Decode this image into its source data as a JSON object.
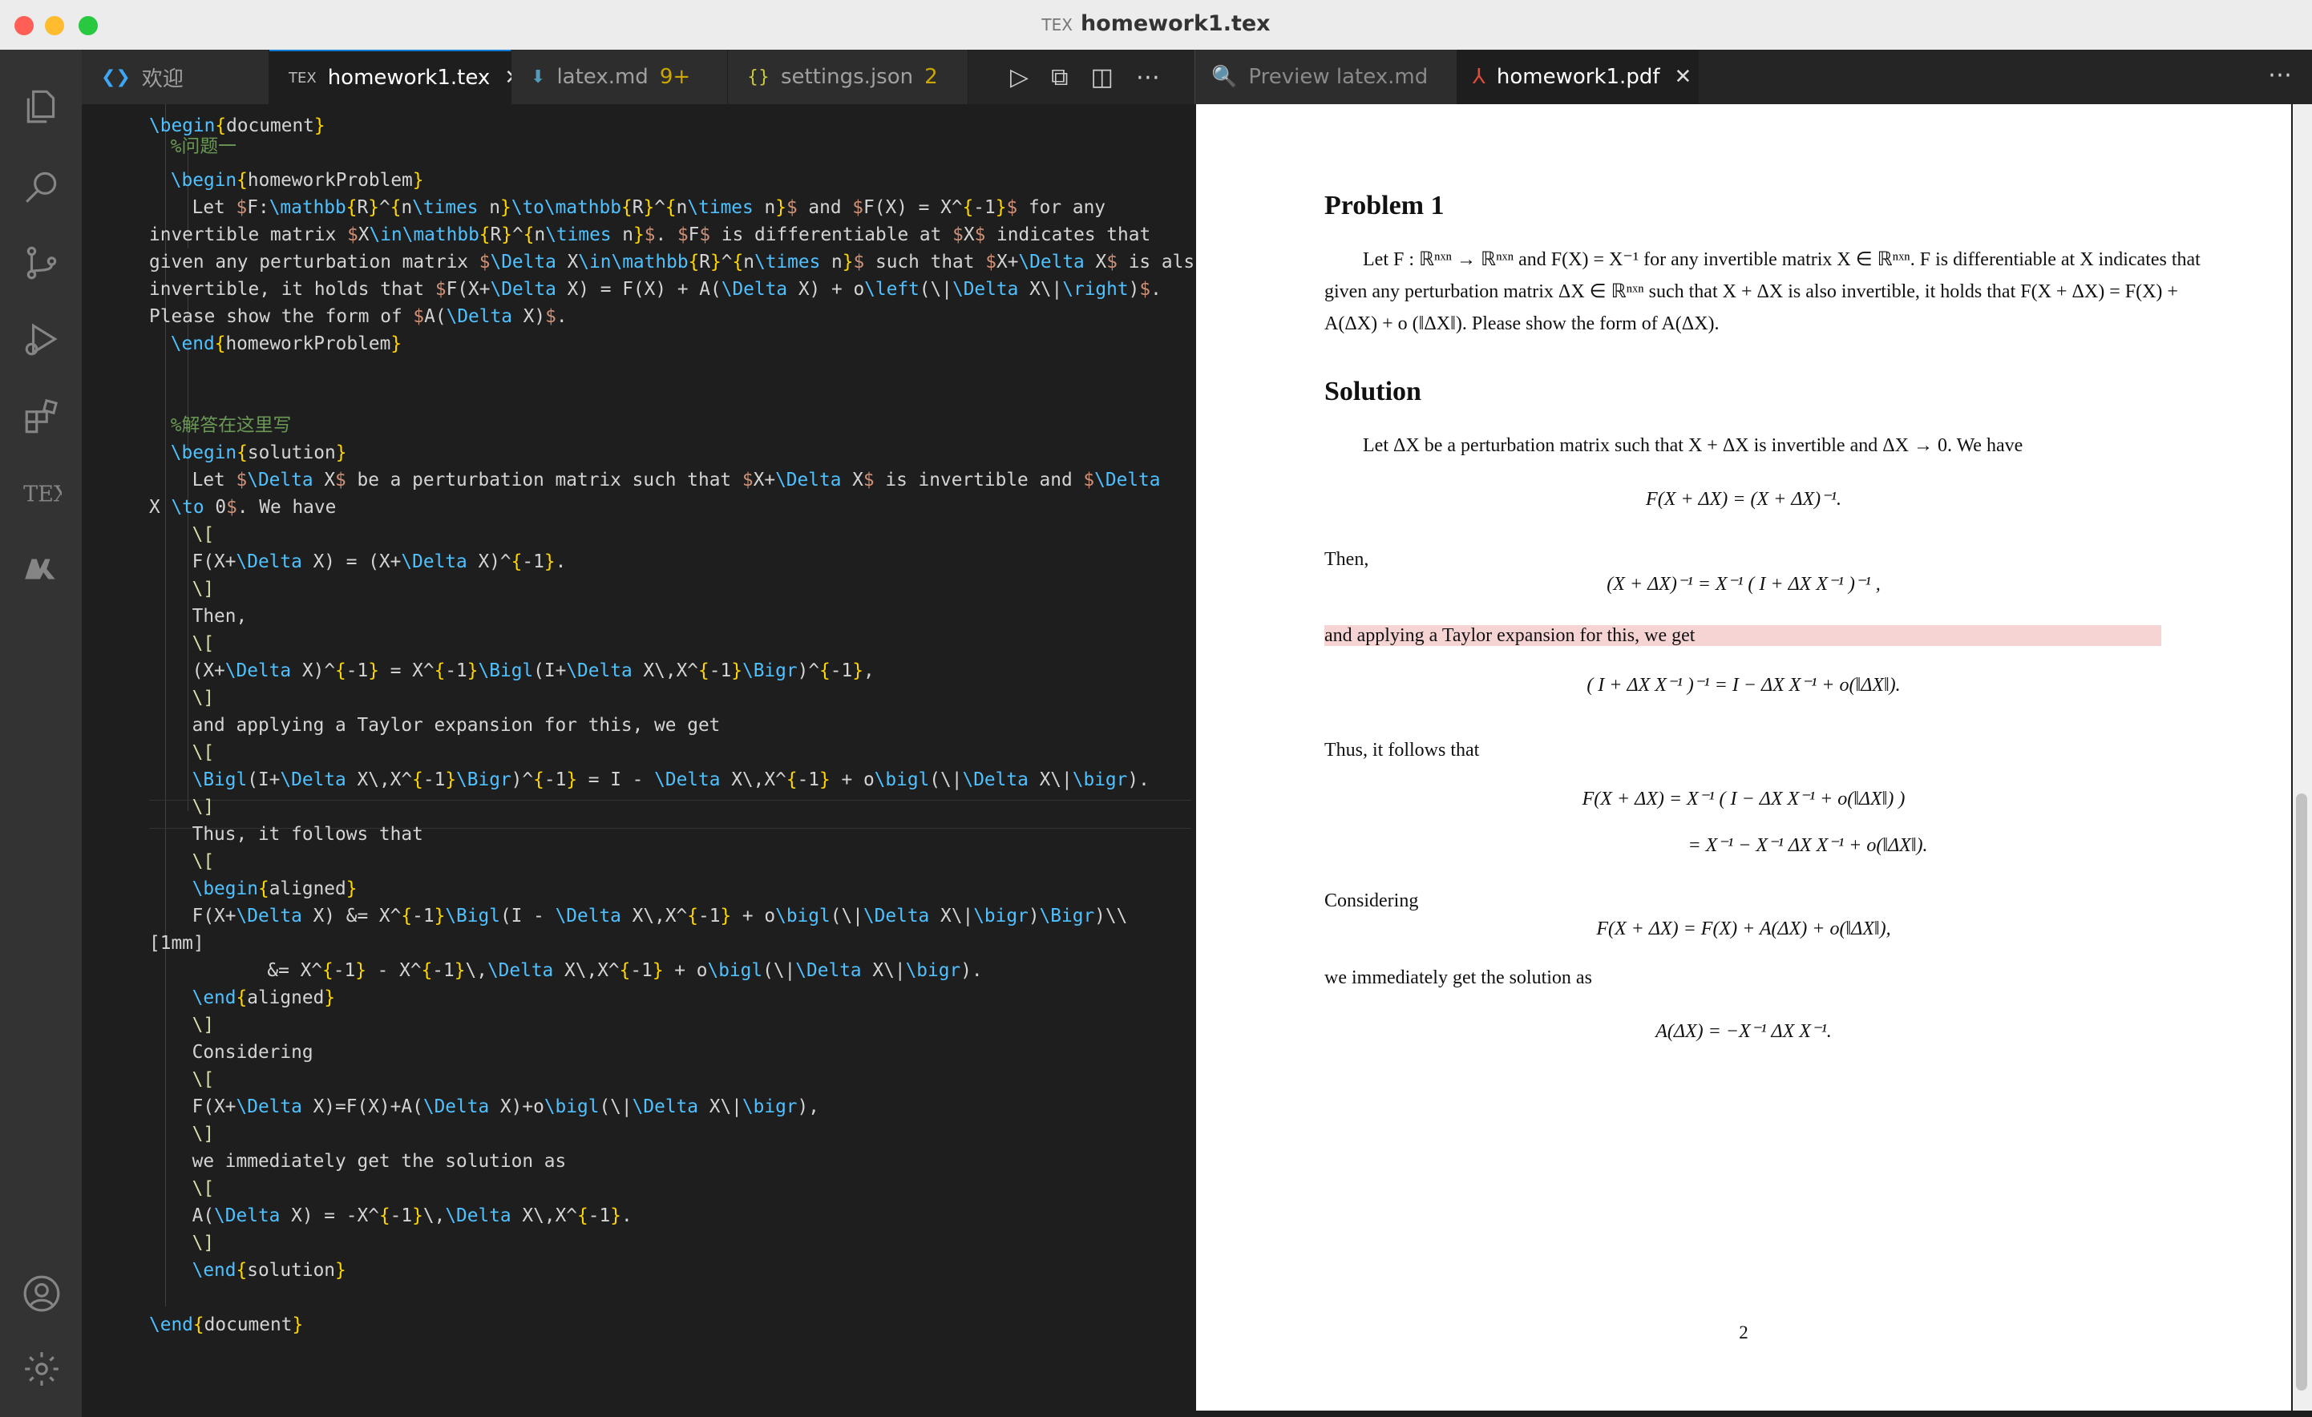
{
  "window": {
    "title": "homework1.tex"
  },
  "tabs": [
    {
      "label": "欢迎",
      "icon": "vscode-icon"
    },
    {
      "label": "homework1.tex",
      "icon": "tex-file-icon"
    },
    {
      "label": "latex.md",
      "badge": "9+",
      "icon": "markdown-file-icon"
    },
    {
      "label": "settings.json",
      "badge": "2",
      "icon": "json-file-icon"
    }
  ],
  "right_tabs": [
    {
      "label": "Preview latex.md"
    },
    {
      "label": "homework1.pdf"
    }
  ],
  "editor": {
    "lines": [
      "\\begin{document}",
      "%问题一",
      "\\begin{homeworkProblem}",
      "Let $F:\\mathbb{R}^{n\\times n}\\to\\mathbb{R}^{n\\times n}$ and $F(X) = X^{-1}$ for any",
      "invertible matrix $X\\in\\mathbb{R}^{n\\times n}$. $F$ is differentiable at $X$ indicates that",
      "given any perturbation matrix $\\Delta X\\in\\mathbb{R}^{n\\times n}$ such that $X+\\Delta X$ is also",
      "invertible, it holds that $F(X+\\Delta X) = F(X) + A(\\Delta X) + o\\left(\\|\\Delta X\\|\\right)$.",
      "Please show the form of $A(\\Delta X)$.",
      "\\end{homeworkProblem}",
      "",
      "",
      "%解答在这里写",
      "\\begin{solution}",
      "Let $\\Delta X$ be a perturbation matrix such that $X+\\Delta X$ is invertible and $\\Delta",
      "X \\to 0$. We have",
      "\\[",
      "F(X+\\Delta X) = (X+\\Delta X)^{-1}.",
      "\\]",
      "Then,",
      "\\[",
      "(X+\\Delta X)^{-1} = X^{-1}\\Bigl(I+\\Delta X\\,X^{-1}\\Bigr)^{-1},",
      "\\]",
      "and applying a Taylor expansion for this, we get",
      "\\[",
      "\\Bigl(I+\\Delta X\\,X^{-1}\\Bigr)^{-1} = I - \\Delta X\\,X^{-1} + o\\bigl(\\|\\Delta X\\|\\bigr).",
      "\\]",
      "Thus, it follows that",
      "\\[",
      "\\begin{aligned}",
      "F(X+\\Delta X) &= X^{-1}\\Bigl(I - \\Delta X\\,X^{-1} + o\\bigl(\\|\\Delta X\\|\\bigr)\\Bigr)\\\\",
      "[1mm]",
      "&= X^{-1} - X^{-1}\\,\\Delta X\\,X^{-1} + o\\bigl(\\|\\Delta X\\|\\bigr).",
      "\\end{aligned}",
      "\\]",
      "Considering",
      "\\[",
      "F(X+\\Delta X)=F(X)+A(\\Delta X)+o\\bigl(\\|\\Delta X\\|\\bigr),",
      "\\]",
      "we immediately get the solution as",
      "\\[",
      "A(\\Delta X) = -X^{-1}\\,\\Delta X\\,X^{-1}.",
      "\\]",
      "\\end{solution}",
      "",
      "\\end{document}"
    ]
  },
  "pdf": {
    "problem_title": "Problem 1",
    "problem_text": "Let F : ℝⁿˣⁿ → ℝⁿˣⁿ and F(X) = X⁻¹ for any invertible matrix X ∈ ℝⁿˣⁿ. F is differentiable at X indicates that given any perturbation matrix ΔX ∈ ℝⁿˣⁿ such that X + ΔX is also invertible, it holds that F(X + ΔX) = F(X) + A(ΔX) + o (‖ΔX‖). Please show the form of A(ΔX).",
    "solution_title": "Solution",
    "solution_intro": "Let ΔX be a perturbation matrix such that X + ΔX is invertible and ΔX → 0. We have",
    "eq1": "F(X + ΔX) = (X + ΔX)⁻¹.",
    "then": "Then,",
    "eq2": "(X + ΔX)⁻¹ = X⁻¹ ( I + ΔX X⁻¹ )⁻¹ ,",
    "taylor": "and applying a Taylor expansion for this, we get",
    "eq3": "( I + ΔX X⁻¹ )⁻¹ = I − ΔX X⁻¹ + o(‖ΔX‖).",
    "thus": "Thus, it follows that",
    "eq4a": "F(X + ΔX) = X⁻¹ ( I − ΔX X⁻¹ + o(‖ΔX‖) )",
    "eq4b": "= X⁻¹ − X⁻¹ ΔX X⁻¹ + o(‖ΔX‖).",
    "considering": "Considering",
    "eq5": "F(X + ΔX) = F(X) + A(ΔX) + o(‖ΔX‖),",
    "immediately": "we immediately get the solution as",
    "eq6": "A(ΔX) = −X⁻¹ ΔX X⁻¹.",
    "page_number": "2"
  }
}
